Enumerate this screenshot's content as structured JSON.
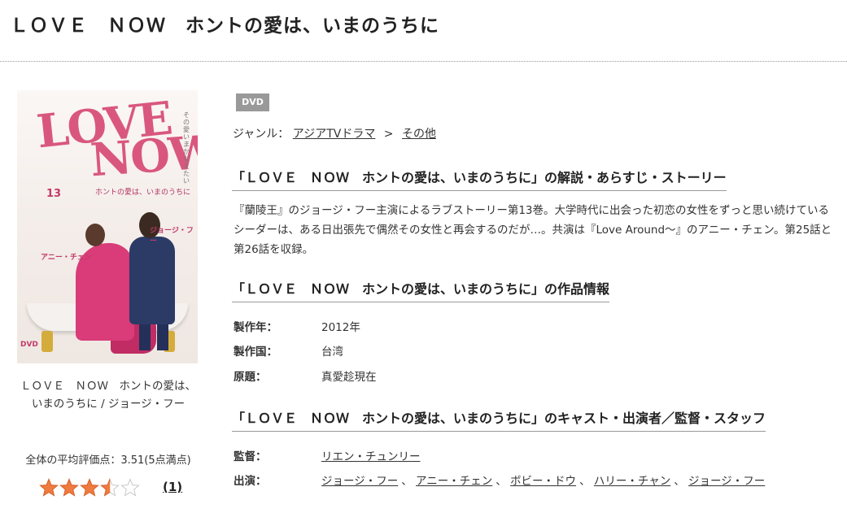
{
  "page": {
    "title": "ＬＯＶＥ　ＮＯＷ　ホントの愛は、いまのうちに"
  },
  "cover": {
    "logo_line1": "LOVE",
    "logo_line2": "NOW",
    "subtitle": "ホントの愛は、いまのうちに",
    "volume": "13",
    "side_text": "その愛いまかなえたい",
    "actor1": "ジョージ・フー",
    "actor2": "アニー・チェン",
    "dvd": "DVD"
  },
  "item": {
    "caption": "ＬＯＶＥ　ＮＯＷ　ホントの愛は、いまのうちに / ジョージ・フー",
    "rating_text": "全体の平均評価点：3.51(5点満点)",
    "rating_value": 3.51,
    "rating_max": 5,
    "review_count": "(1)",
    "star_fill_color": "#f07b3f"
  },
  "product": {
    "badge": "DVD",
    "genre_label": "ジャンル：",
    "genres": [
      "アジアTVドラマ",
      "その他"
    ],
    "genre_separator": ">"
  },
  "synopsis_section": {
    "heading": "「ＬＯＶＥ　ＮＯＷ　ホントの愛は、いまのうちに」の解説・あらすじ・ストーリー",
    "text": "『蘭陵王』のジョージ・フー主演によるラブストーリー第13巻。大学時代に出会った初恋の女性をずっと思い続けているシーダーは、ある日出張先で偶然その女性と再会するのだが…。共演は『Love Around～』のアニー・チェン。第25話と第26話を収録。"
  },
  "info_section": {
    "heading": "「ＬＯＶＥ　ＮＯＷ　ホントの愛は、いまのうちに」の作品情報",
    "rows": [
      {
        "label": "製作年：",
        "value": "2012年"
      },
      {
        "label": "製作国：",
        "value": "台湾"
      },
      {
        "label": "原題：",
        "value": "真愛趁現在"
      }
    ]
  },
  "cast_section": {
    "heading": "「ＬＯＶＥ　ＮＯＷ　ホントの愛は、いまのうちに」のキャスト・出演者／監督・スタッフ",
    "director_label": "監督：",
    "director": "リエン・チュンリー",
    "cast_label": "出演：",
    "cast": [
      "ジョージ・フー",
      "アニー・チェン",
      "ボビー・ドウ",
      "ハリー・チャン",
      "ジョージ・フー"
    ],
    "cast_separator": "、"
  }
}
